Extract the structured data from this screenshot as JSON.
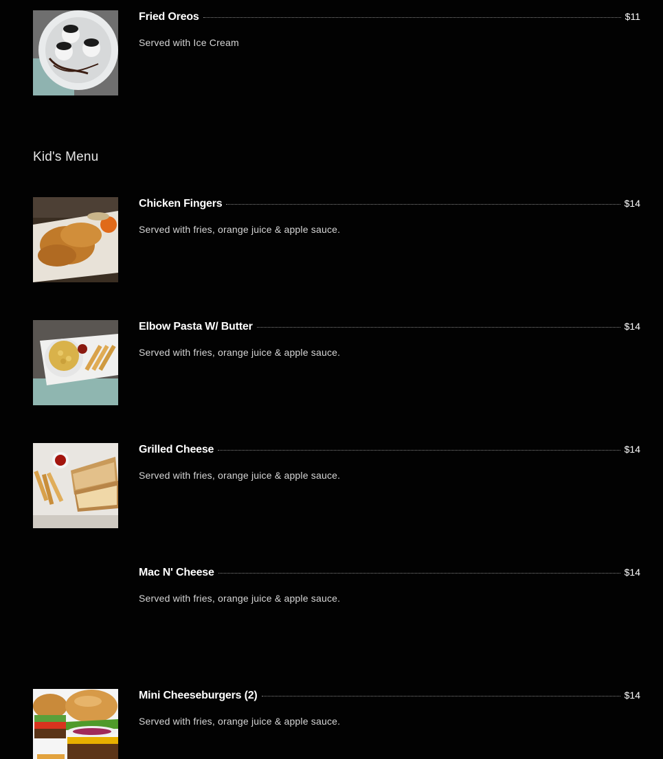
{
  "top_item": {
    "name": "Fried Oreos",
    "price": "$11",
    "description": "Served with Ice Cream",
    "image": "fried-oreos-photo"
  },
  "section": {
    "title": "Kid's Menu",
    "items": [
      {
        "name": "Chicken Fingers",
        "price": "$14",
        "description": "Served with fries, orange juice & apple sauce.",
        "image": "chicken-fingers-photo"
      },
      {
        "name": "Elbow Pasta W/ Butter",
        "price": "$14",
        "description": "Served with fries, orange juice & apple sauce.",
        "image": "elbow-pasta-photo"
      },
      {
        "name": "Grilled Cheese",
        "price": "$14",
        "description": "Served with fries, orange juice & apple sauce.",
        "image": "grilled-cheese-photo"
      },
      {
        "name": "Mac N' Cheese",
        "price": "$14",
        "description": "Served with fries, orange juice & apple sauce.",
        "image": null
      },
      {
        "name": "Mini Cheeseburgers (2)",
        "price": "$14",
        "description": "Served with fries, orange juice & apple sauce.",
        "image": "mini-cheeseburgers-photo"
      }
    ]
  },
  "colors": {
    "background": "#020202",
    "text": "#ffffff",
    "description": "#d6d6d6",
    "dot_leader": "#8a8a8a"
  }
}
